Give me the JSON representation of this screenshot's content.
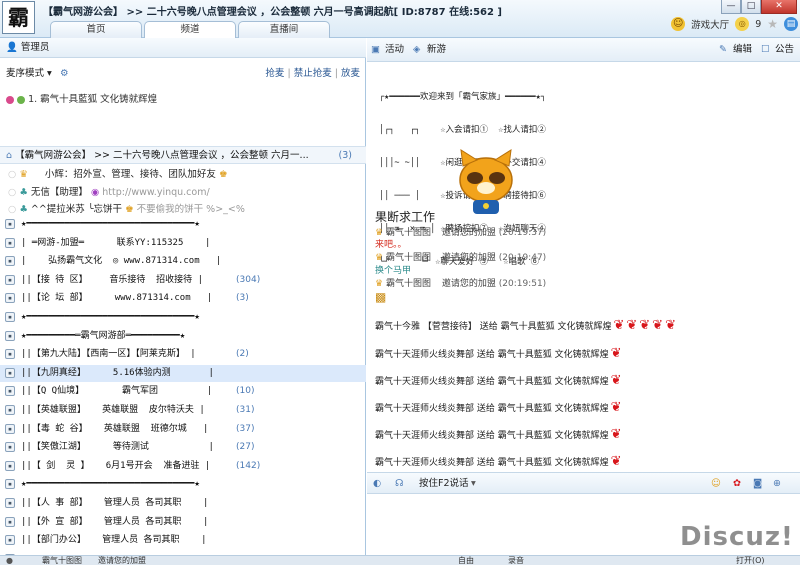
{
  "window": {
    "title": "【霸气网游公会】 >> 二十六号晚八点管理会议 ，公会整顿 六月一号高调起航[ ID:8787 在线:562 ]",
    "tabs": [
      "首页",
      "频道",
      "直播间"
    ],
    "top_right": {
      "hall": "游戏大厅",
      "count": "9"
    }
  },
  "left": {
    "admin_label": "管理员",
    "mic_mode": "麦序模式",
    "mic_actions": [
      "抢麦",
      "禁止抢麦",
      "放麦"
    ],
    "queue_item": "1. 霸气十具藍狐 文化铸就辉煌",
    "channel_head": "【霸气网游公会】 >> 二十六号晚八点管理会议 ，公会整顿 六月一...",
    "channel_count": "(3)",
    "members": [
      {
        "name": "小辉：招外宣、管理、接待、团队加好友"
      },
      {
        "name": "无信【助理】",
        "extra": "http://www.yinqu.com/"
      },
      {
        "name": "^^提拉米苏 ╰忘饼干",
        "extra": "不要偷我的饼干 %>_<%"
      }
    ],
    "rooms": [
      {
        "text": "★━━━━━━━━━━━━━━━━━━━━━━━━━━━━━━━★",
        "count": ""
      },
      {
        "text": "| ═网游-加盟═      联系YY:115325    |",
        "count": ""
      },
      {
        "text": "|    弘扬霸气文化  ◎ www.871314.com   |",
        "count": ""
      },
      {
        "text": "||【接 待 区】    音乐接待  招收接待 |",
        "count": "(304)"
      },
      {
        "text": "||【论 坛 部】     www.871314.com   |",
        "count": "(3)"
      },
      {
        "text": "★━━━━━━━━━━━━━━━━━━━━━━━━━━━━━━━★",
        "count": ""
      },
      {
        "text": "★━━━━━━━━━═霸气网游部═━━━━━━━━━★",
        "count": ""
      },
      {
        "text": "||【第九大陆】【西南一区】【阿莱克斯】 |",
        "count": "(2)"
      },
      {
        "text": "||【九阴真经】     5.16体验内测       |",
        "count": ""
      },
      {
        "text": "||【Q Q仙境】       霸气军团         |",
        "count": "(10)"
      },
      {
        "text": "||【英雄联盟】   英雄联盟  皮尔特沃夫 |",
        "count": "(31)"
      },
      {
        "text": "||【毒 蛇 谷】   英雄联盟  班德尔城   |",
        "count": "(37)"
      },
      {
        "text": "||【笑傲江湖】     等待测试           |",
        "count": "(27)"
      },
      {
        "text": "||【 剑  灵 】   6月1号开会  准备进驻 |",
        "count": "(142)"
      },
      {
        "text": "★━━━━━━━━━━━━━━━━━━━━━━━━━━━━━━━★",
        "count": ""
      },
      {
        "text": "||【人 事 部】   管理人员 各司其职    |",
        "count": ""
      },
      {
        "text": "||【外 宣 部】   管理人员 各司其职    |",
        "count": ""
      },
      {
        "text": "||【部门办公】   管理人员 各司其职    |",
        "count": ""
      },
      {
        "text": "★━━━━━━━━━━━━━━━━━━━━━━━━━━━━━━━★",
        "count": ""
      }
    ]
  },
  "right": {
    "toolbar": {
      "activity": "活动",
      "new_game": "新游",
      "edit": "编辑",
      "notice": "公告"
    },
    "banner_lines": [
      "┌★━━━━━━欢迎来到「霸气家族」━━━━━━★┐",
      "│┌┐   ┌┐    ☆入会请扣①  ☆找人请扣②",
      "│││~ ~││    ☆闲逛请扣③  ☆外交请扣④",
      "││ ─── │    ☆投诉请扣⑤  ☆聘接待扣⑥",
      "││ =  × = │ ☆聘场控扣⑦  ☆泡妞聊天④",
      "└┘      └┘ ☆聊天爱好 ⑤   ☆唱歌 ⑥"
    ],
    "chat": [
      {
        "type": "big",
        "text": "果断求工作"
      },
      {
        "type": "sys",
        "user": "霸气十图图",
        "msg": "邀请您的加盟",
        "time": "(20:19:37)"
      },
      {
        "type": "red",
        "text": "来吧。。"
      },
      {
        "type": "sys",
        "user": "霸气十图图",
        "msg": "邀请您的加盟",
        "time": "(20:19:47)"
      },
      {
        "type": "teal",
        "text": "换个马甲"
      },
      {
        "type": "sys",
        "user": "霸气十图图",
        "msg": "邀请您的加盟",
        "time": "(20:19:51)"
      }
    ],
    "gifts": [
      {
        "text": "霸气十今雅     【菅营接待】 送给 霸气十具藍狐 文化铸就辉煌",
        "roses": 5
      },
      {
        "text": "霸气十天涯师火线炎舞部 送给 霸气十具藍狐 文化铸就辉煌",
        "roses": 1
      },
      {
        "text": "霸气十天涯师火线炎舞部 送给 霸气十具藍狐 文化铸就辉煌",
        "roses": 1
      },
      {
        "text": "霸气十天涯师火线炎舞部 送给 霸气十具藍狐 文化铸就辉煌",
        "roses": 1
      },
      {
        "text": "霸气十天涯师火线炎舞部 送给 霸气十具藍狐 文化铸就辉煌",
        "roses": 1
      },
      {
        "text": "霸气十天涯师火线炎舞部 送给 霸气十具藍狐 文化铸就辉煌",
        "roses": 1
      }
    ],
    "input_bar": {
      "ptt": "按住F2说话"
    }
  },
  "status": {
    "user": "霸气十图图",
    "msg": "邀请您的加盟",
    "free": "自由",
    "record": "录音",
    "open": "打开(O)"
  },
  "watermark": "Discuz!",
  "colors": {
    "accent": "#2d5a94",
    "rose": "#d8161b",
    "selected_row": "#dbe9fb",
    "title_bar": "#dbeaf6"
  }
}
